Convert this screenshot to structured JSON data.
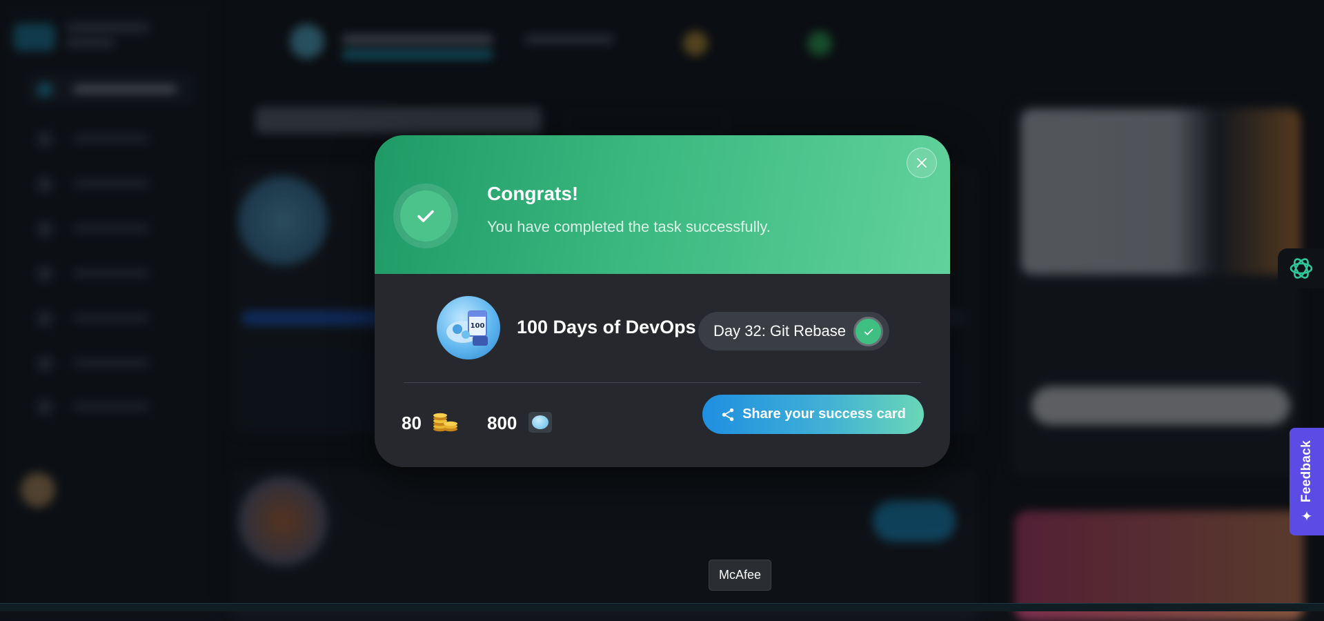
{
  "modal": {
    "title": "Congrats!",
    "subtitle": "You have completed the task successfully.",
    "course": {
      "title": "100 Days of DevOps",
      "icon": "100-days-devops-icon",
      "icon_text": "100"
    },
    "task": {
      "label": "Day 32: Git Rebase",
      "status": "completed"
    },
    "rewards": {
      "coins": "80",
      "coins_icon": "coins-icon",
      "gems": "800",
      "gems_icon": "gem-icon"
    },
    "share_button": "Share your success card",
    "close_icon": "close-icon"
  },
  "side": {
    "feedback_label": "Feedback",
    "ai_icon": "openai-icon"
  },
  "tooltip": "McAfee",
  "colors": {
    "header_gradient_start": "#1f9a66",
    "header_gradient_end": "#62d29c",
    "modal_bg": "#26282e",
    "share_gradient_start": "#1f8fe0",
    "share_gradient_end": "#6ad7b6",
    "feedback_bg": "#5b4ce6"
  }
}
